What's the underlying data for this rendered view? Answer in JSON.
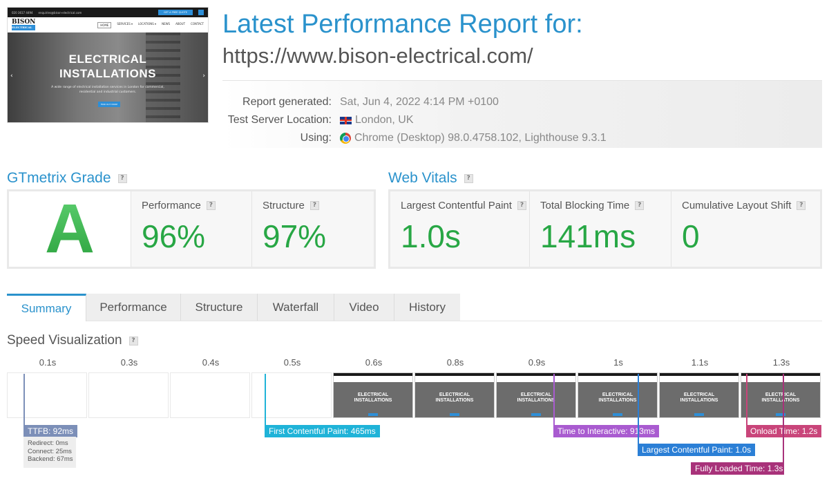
{
  "header": {
    "title": "Latest Performance Report for:",
    "url": "https://www.bison-electrical.com/",
    "meta": [
      {
        "label": "Report generated:",
        "value": "Sat, Jun 4, 2022 4:14 PM +0100",
        "icon": ""
      },
      {
        "label": "Test Server Location:",
        "value": "London, UK",
        "icon": "uk-flag-icon"
      },
      {
        "label": "Using:",
        "value": "Chrome (Desktop) 98.0.4758.102, Lighthouse 9.3.1",
        "icon": "chrome-icon"
      }
    ]
  },
  "screenshot": {
    "logo": "BISON",
    "logo_sub": "ELECTRICAL",
    "menu": [
      "HOME",
      "SERVICES ▾",
      "LOCATIONS ▾",
      "NEWS",
      "ABOUT",
      "CONTACT"
    ],
    "heading": "ELECTRICAL INSTALLATIONS",
    "text": "A wide range of electrical installation services in London for commercial, residential and industrial customers.",
    "cta": "FIND OUT MORE",
    "top_phone": "020 3617 4494",
    "top_email": "enquiries@bison-electrical.com",
    "top_button": "GET A FREE QUOTE"
  },
  "gtmetrix_grade": {
    "title": "GTmetrix Grade",
    "help": "?",
    "grade": "A",
    "performance_label": "Performance",
    "performance_value": "96%",
    "structure_label": "Structure",
    "structure_value": "97%"
  },
  "web_vitals": {
    "title": "Web Vitals",
    "help": "?",
    "lcp_label": "Largest Contentful Paint",
    "lcp_value": "1.0s",
    "tbt_label": "Total Blocking Time",
    "tbt_value": "141ms",
    "cls_label": "Cumulative Layout Shift",
    "cls_value": "0"
  },
  "tabs": [
    "Summary",
    "Performance",
    "Structure",
    "Waterfall",
    "Video",
    "History"
  ],
  "active_tab": "Summary",
  "speed": {
    "title": "Speed Visualization",
    "help": "?",
    "times": [
      "0.1s",
      "0.3s",
      "0.4s",
      "0.5s",
      "0.6s",
      "0.8s",
      "0.9s",
      "1s",
      "1.1s",
      "1.3s"
    ],
    "frame_heading": "ELECTRICAL INSTALLATIONS",
    "ttfb": "TTFB: 92ms",
    "ttfb_details": [
      "Redirect: 0ms",
      "Connect: 25ms",
      "Backend: 67ms"
    ],
    "fcp": "First Contentful Paint: 465ms",
    "tti": "Time to Interactive: 913ms",
    "lcp": "Largest Contentful Paint: 1.0s",
    "onload": "Onload Time: 1.2s",
    "fully_loaded": "Fully Loaded Time: 1.3s"
  },
  "colors": {
    "brand_blue": "#2a92cc",
    "good_green": "#28a745",
    "ttfb": "#7c8fb8",
    "fcp": "#1fb3d8",
    "tti": "#a95bd0",
    "lcp": "#2b7fd6",
    "onload": "#c9457a",
    "fully_loaded": "#a8327a"
  }
}
